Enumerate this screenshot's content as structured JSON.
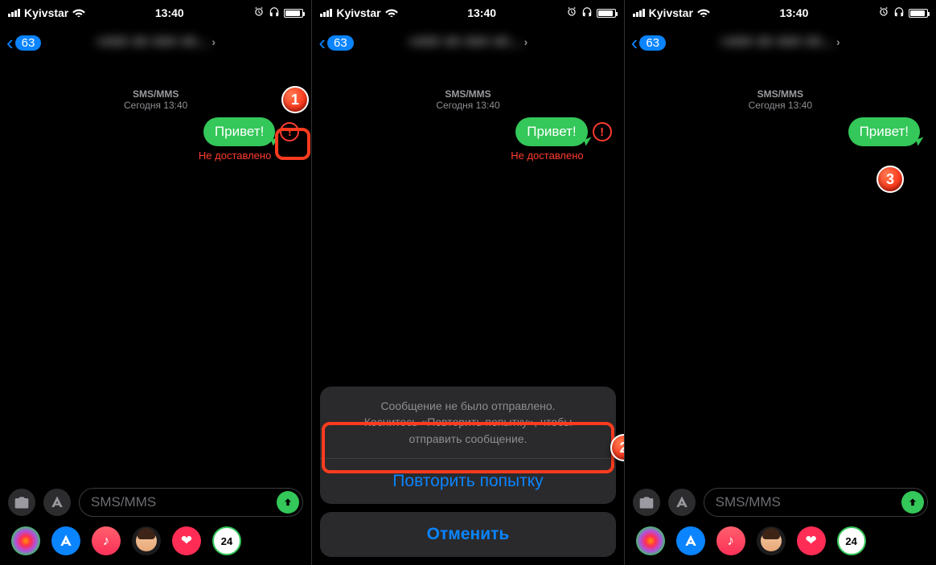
{
  "status": {
    "carrier": "Kyivstar",
    "time": "13:40"
  },
  "nav": {
    "back_count": "63",
    "title_obscured": "+### ## ### ##...",
    "chevron": "›"
  },
  "thread": {
    "type": "SMS/MMS",
    "date_label": "Сегодня 13:40"
  },
  "message": {
    "text": "Привет!",
    "error": "!"
  },
  "not_delivered": "Не доставлено",
  "composer": {
    "placeholder": "SMS/MMS"
  },
  "app_badge": "24",
  "sheet": {
    "line1": "Сообщение не было отправлено.",
    "line2": "Коснитесь «Повторить попытку», чтобы",
    "line3": "отправить сообщение.",
    "retry": "Повторить попытку",
    "cancel": "Отменить"
  },
  "markers": {
    "m1": "1",
    "m2": "2",
    "m3": "3"
  }
}
